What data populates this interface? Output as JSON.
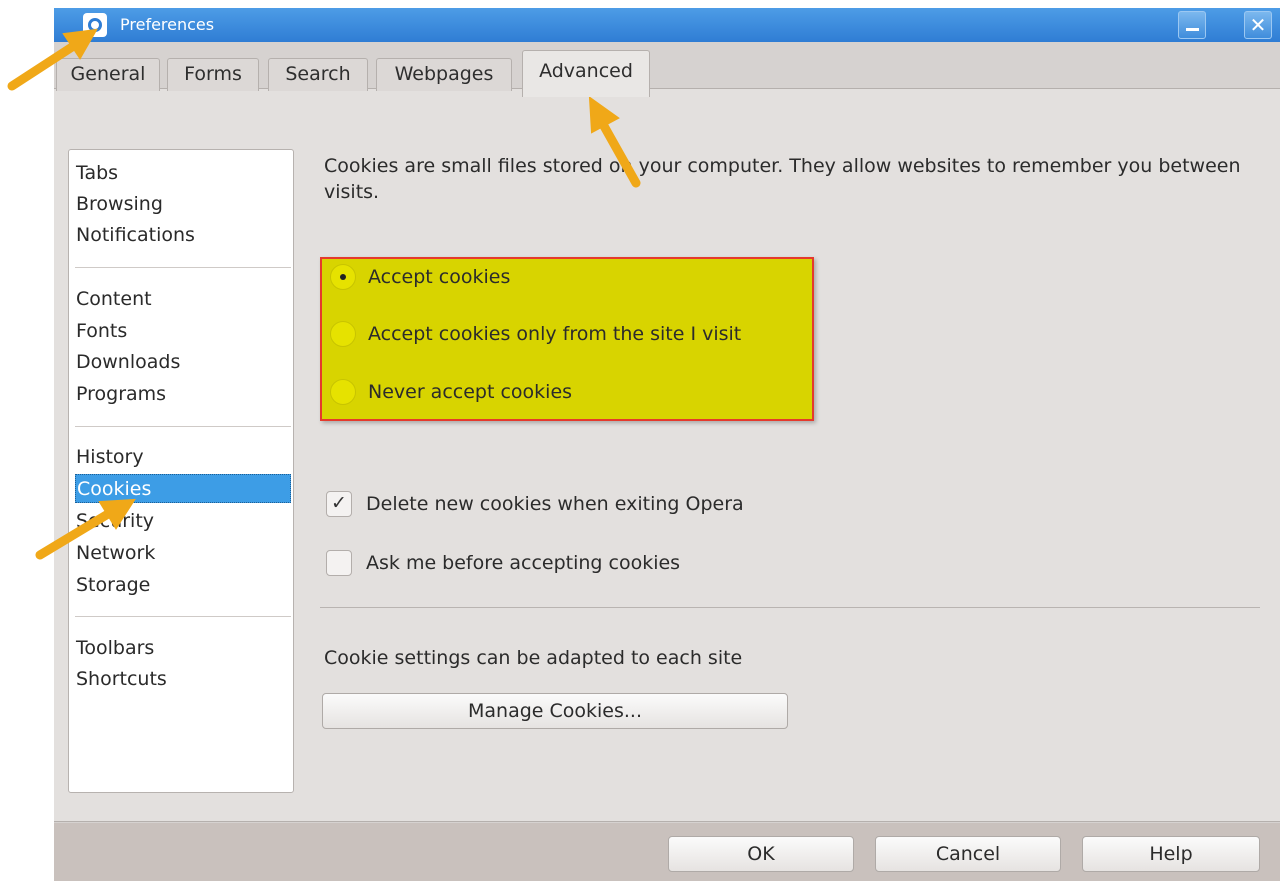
{
  "window": {
    "title": "Preferences",
    "close_glyph": "✕"
  },
  "icons": {
    "opera_logo": "opera-logo-icon",
    "app_icon": "preferences-icon",
    "minimize": "minimize-icon",
    "close": "close-icon",
    "check": "✓"
  },
  "colors": {
    "titlebar": "#2f7dd4",
    "selection": "#3d9de6",
    "highlight_fill": "#d8d400",
    "highlight_border": "#e53a2c",
    "arrow": "#f0a818"
  },
  "tabs": [
    {
      "label": "General"
    },
    {
      "label": "Forms"
    },
    {
      "label": "Search"
    },
    {
      "label": "Webpages"
    },
    {
      "label": "Advanced",
      "active": true
    }
  ],
  "sidebar": {
    "groups": [
      [
        "Tabs",
        "Browsing",
        "Notifications"
      ],
      [
        "Content",
        "Fonts",
        "Downloads",
        "Programs"
      ],
      [
        "History",
        "Cookies",
        "Security",
        "Network",
        "Storage"
      ],
      [
        "Toolbars",
        "Shortcuts"
      ]
    ],
    "selected": "Cookies"
  },
  "main": {
    "intro": "Cookies are small files stored on your computer. They allow websites to remember you between visits.",
    "radio_options": [
      {
        "label": "Accept cookies",
        "checked": true
      },
      {
        "label": "Accept cookies only from the site I visit",
        "checked": false
      },
      {
        "label": "Never accept cookies",
        "checked": false
      }
    ],
    "checkboxes": [
      {
        "label": "Delete new cookies when exiting Opera",
        "checked": true
      },
      {
        "label": "Ask me before accepting cookies",
        "checked": false
      }
    ],
    "note": "Cookie settings can be adapted to each site",
    "manage_button": "Manage Cookies..."
  },
  "footer": {
    "ok": "OK",
    "cancel": "Cancel",
    "help": "Help"
  }
}
